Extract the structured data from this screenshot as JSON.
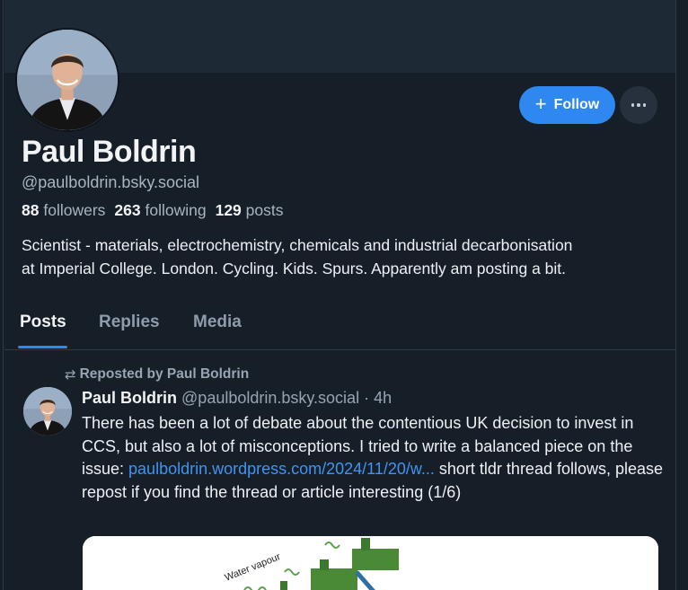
{
  "profile": {
    "display_name": "Paul Boldrin",
    "handle": "@paulboldrin.bsky.social",
    "followers_count": "88",
    "followers_label": "followers",
    "following_count": "263",
    "following_label": "following",
    "posts_count": "129",
    "posts_label": "posts",
    "bio_line1": "Scientist - materials, electrochemistry, chemicals and industrial decarbonisation",
    "bio_line2": "at Imperial College. London. Cycling. Kids. Spurs. Apparently am posting a bit."
  },
  "actions": {
    "follow_label": "Follow",
    "follow_icon": "plus-icon",
    "more_icon": "ellipsis-icon"
  },
  "tabs": [
    {
      "label": "Posts",
      "active": true
    },
    {
      "label": "Replies",
      "active": false
    },
    {
      "label": "Media",
      "active": false
    }
  ],
  "feed": {
    "repost_label": "Reposted by Paul Boldrin",
    "post": {
      "author_name": "Paul Boldrin",
      "author_handle": "@paulboldrin.bsky.social",
      "separator": "·",
      "time": "4h",
      "text_part1": "There has been a lot of debate about the contentious UK decision to invest in CCS, but also a lot of misconceptions. I tried to write a balanced piece on the issue: ",
      "link_text": "paulboldrin.wordpress.com/2024/11/20/w...",
      "text_part2": " short tldr thread follows, please repost if you find the thread or article interesting (1/6)",
      "embed_caption": "Water vapour"
    }
  },
  "colors": {
    "background": "#161e27",
    "banner": "#1e2936",
    "accent": "#2f87f0",
    "link": "#3f95f2",
    "muted_text": "#aab5c1"
  }
}
